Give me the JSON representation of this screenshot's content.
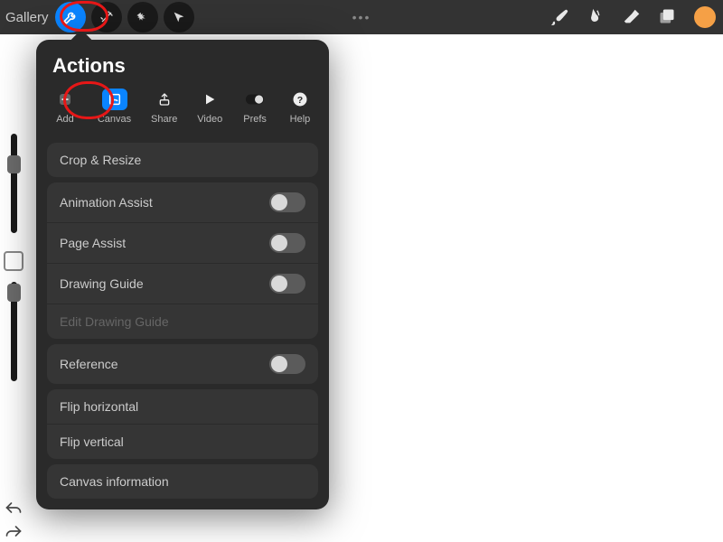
{
  "topbar": {
    "gallery_label": "Gallery"
  },
  "actions_panel": {
    "title": "Actions",
    "tabs": {
      "add": "Add",
      "canvas": "Canvas",
      "share": "Share",
      "video": "Video",
      "prefs": "Prefs",
      "help": "Help"
    },
    "items": {
      "crop_resize": "Crop & Resize",
      "animation_assist": "Animation Assist",
      "page_assist": "Page Assist",
      "drawing_guide": "Drawing Guide",
      "edit_drawing_guide": "Edit Drawing Guide",
      "reference": "Reference",
      "flip_horizontal": "Flip horizontal",
      "flip_vertical": "Flip vertical",
      "canvas_info": "Canvas information"
    }
  }
}
